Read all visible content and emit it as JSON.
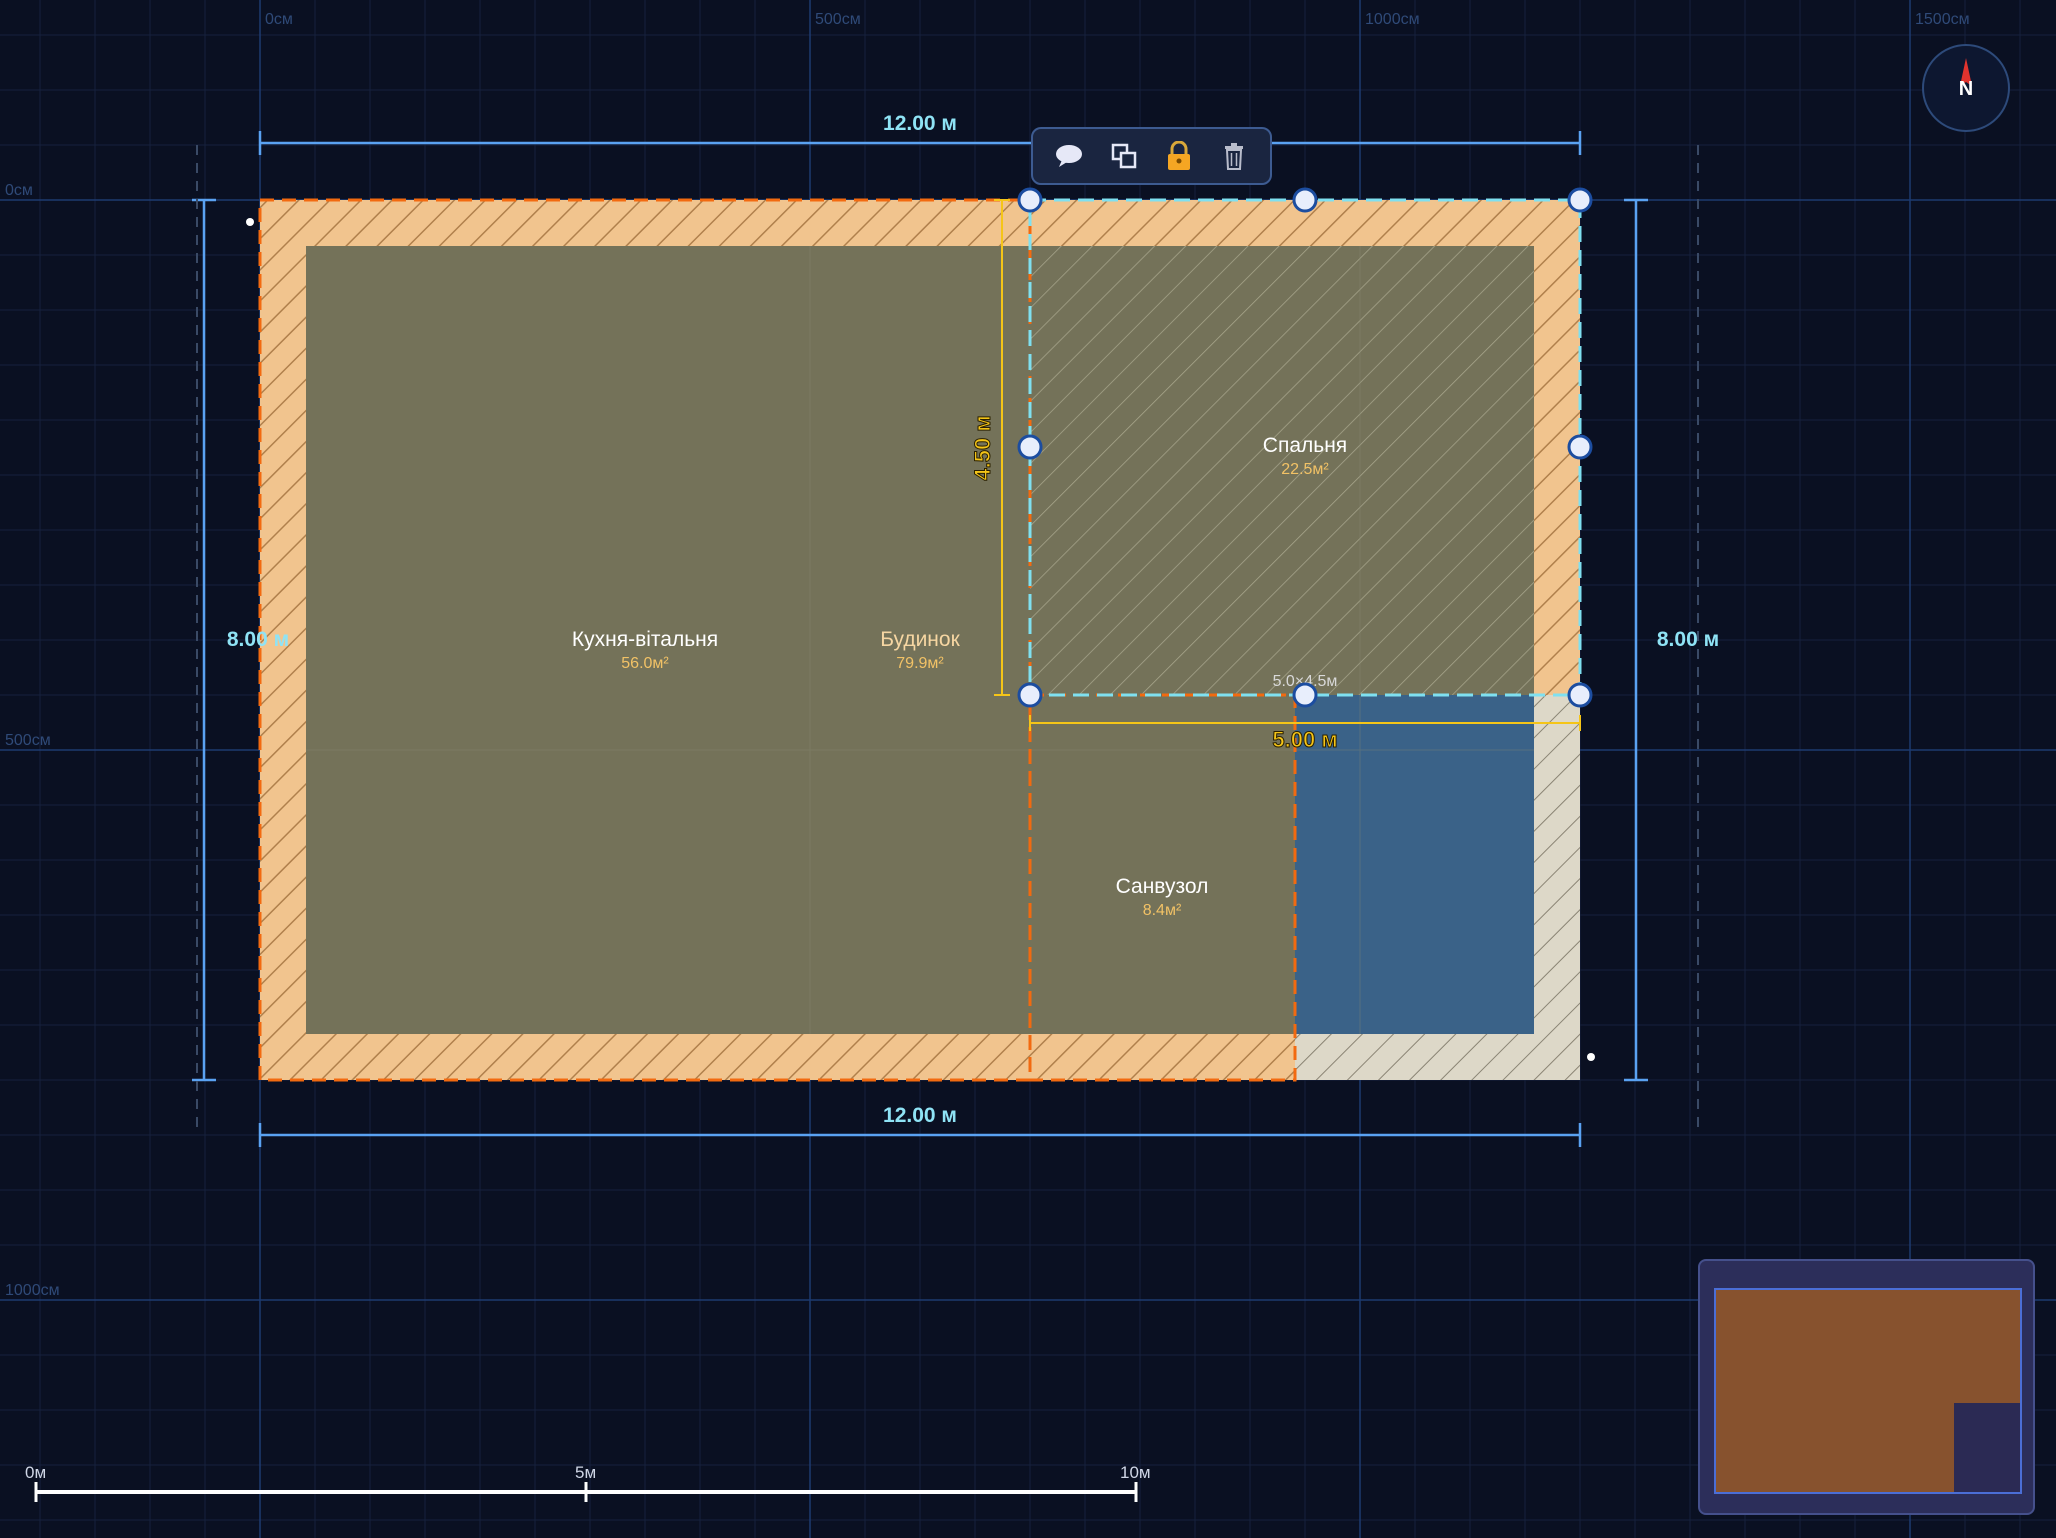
{
  "grid": {
    "top_labels": [
      "0см",
      "500см",
      "1000см",
      "1500см"
    ],
    "left_labels": [
      "0см",
      "500см",
      "1000см"
    ]
  },
  "dimensions": {
    "top_width": "12.00 м",
    "bottom_width": "12.00 м",
    "left_height": "8.00 м",
    "right_height": "8.00 м",
    "selection_height": "4.50 м",
    "selection_width": "5.00 м",
    "selection_size": "5.0×4.5м"
  },
  "rooms": {
    "kitchen": {
      "name": "Кухня-вітальня",
      "area": "56.0м²"
    },
    "house": {
      "name": "Будинок",
      "area": "79.9м²"
    },
    "bedroom": {
      "name": "Спальня",
      "area": "22.5м²"
    },
    "bathroom": {
      "name": "Санвузол",
      "area": "8.4м²"
    }
  },
  "toolbar": {
    "icons": [
      "comment-icon",
      "duplicate-icon",
      "lock-icon",
      "trash-icon"
    ]
  },
  "compass": {
    "label": "N"
  },
  "scale_bar": {
    "labels": [
      "0м",
      "5м",
      "10м"
    ]
  },
  "colors": {
    "background": "#0a1022",
    "wall": "#f1c48e",
    "floor": "#747259",
    "selection": "#7fe0f0",
    "dimension": "#5aa2f2",
    "accent_yellow": "#f5c518",
    "orange_dash": "#f26a10",
    "blue_area": "#3a6288"
  }
}
